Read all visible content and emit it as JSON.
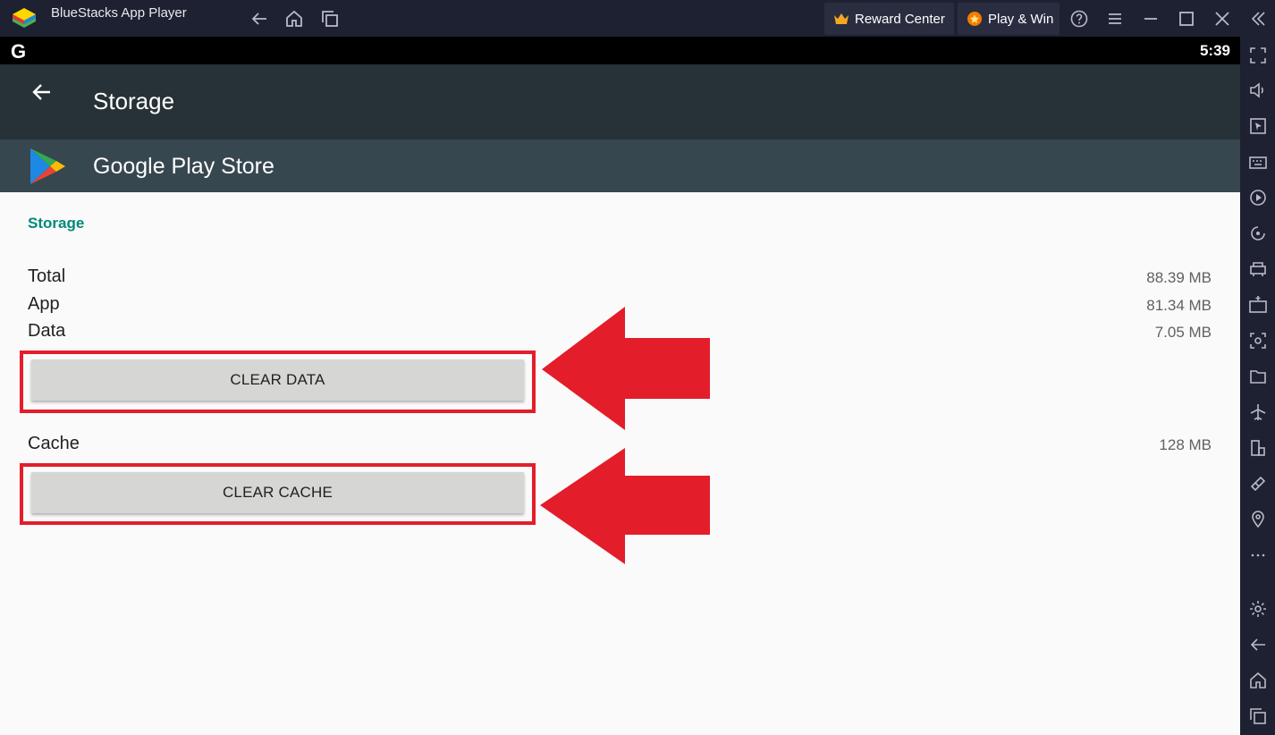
{
  "window": {
    "app_title": "BlueStacks App Player",
    "reward_center": "Reward Center",
    "play_win": "Play & Win"
  },
  "status_bar": {
    "g_label": "G",
    "time": "5:39"
  },
  "app_bar": {
    "title": "Storage"
  },
  "app_info": {
    "name": "Google Play Store"
  },
  "storage": {
    "section_title": "Storage",
    "rows": [
      {
        "label": "Total",
        "value": "88.39 MB"
      },
      {
        "label": "App",
        "value": "81.34 MB"
      },
      {
        "label": "Data",
        "value": "7.05 MB"
      }
    ],
    "clear_data_label": "CLEAR DATA",
    "cache": {
      "label": "Cache",
      "value": "128 MB"
    },
    "clear_cache_label": "CLEAR CACHE"
  },
  "annotation": {
    "color": "#e31d2a"
  },
  "colors": {
    "accent": "#00897b",
    "app_bar": "#263238",
    "app_row": "#37474f",
    "window_chrome": "#1e2132"
  },
  "sidebar_icons": [
    "fullscreen-icon",
    "volume-icon",
    "cursor-icon",
    "keyboard-icon",
    "macro-play-icon",
    "rotate-sync-icon",
    "multi-instance-icon",
    "apk-install-icon",
    "screenshot-icon",
    "folder-icon",
    "airplane-icon",
    "phone-layout-icon",
    "eco-mode-icon",
    "location-icon",
    "more-icon",
    "settings-icon",
    "back-icon",
    "home-icon",
    "recents-icon"
  ]
}
